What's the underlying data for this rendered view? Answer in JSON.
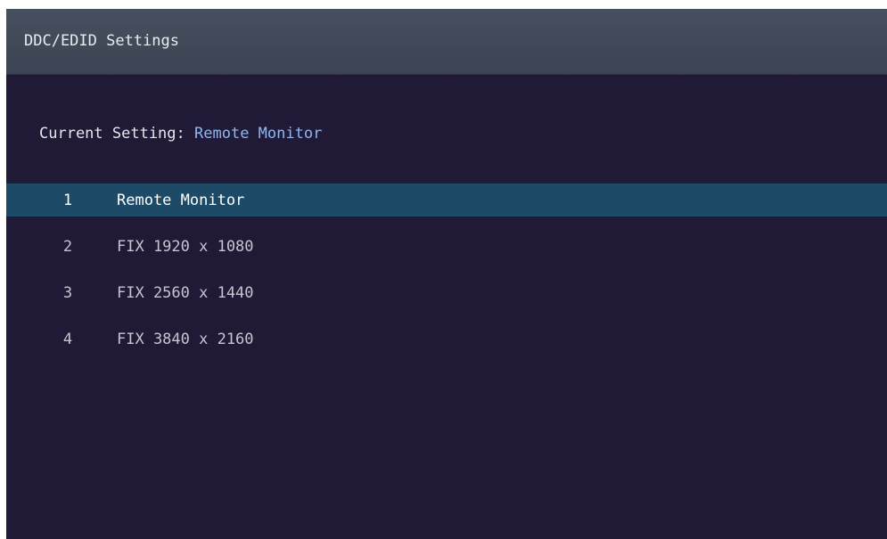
{
  "window": {
    "title": "DDC/EDID Settings"
  },
  "current": {
    "label": "Current Setting:",
    "value": "Remote Monitor"
  },
  "options": [
    {
      "number": "1",
      "label": "Remote Monitor",
      "selected": true
    },
    {
      "number": "2",
      "label": "FIX 1920 x 1080",
      "selected": false
    },
    {
      "number": "3",
      "label": "FIX 2560 x 1440",
      "selected": false
    },
    {
      "number": "4",
      "label": "FIX 3840 x 2160",
      "selected": false
    }
  ],
  "colors": {
    "background": "#211a36",
    "title_bar": "#404957",
    "highlight": "#1d4a66",
    "current_value": "#8fb8f2"
  }
}
